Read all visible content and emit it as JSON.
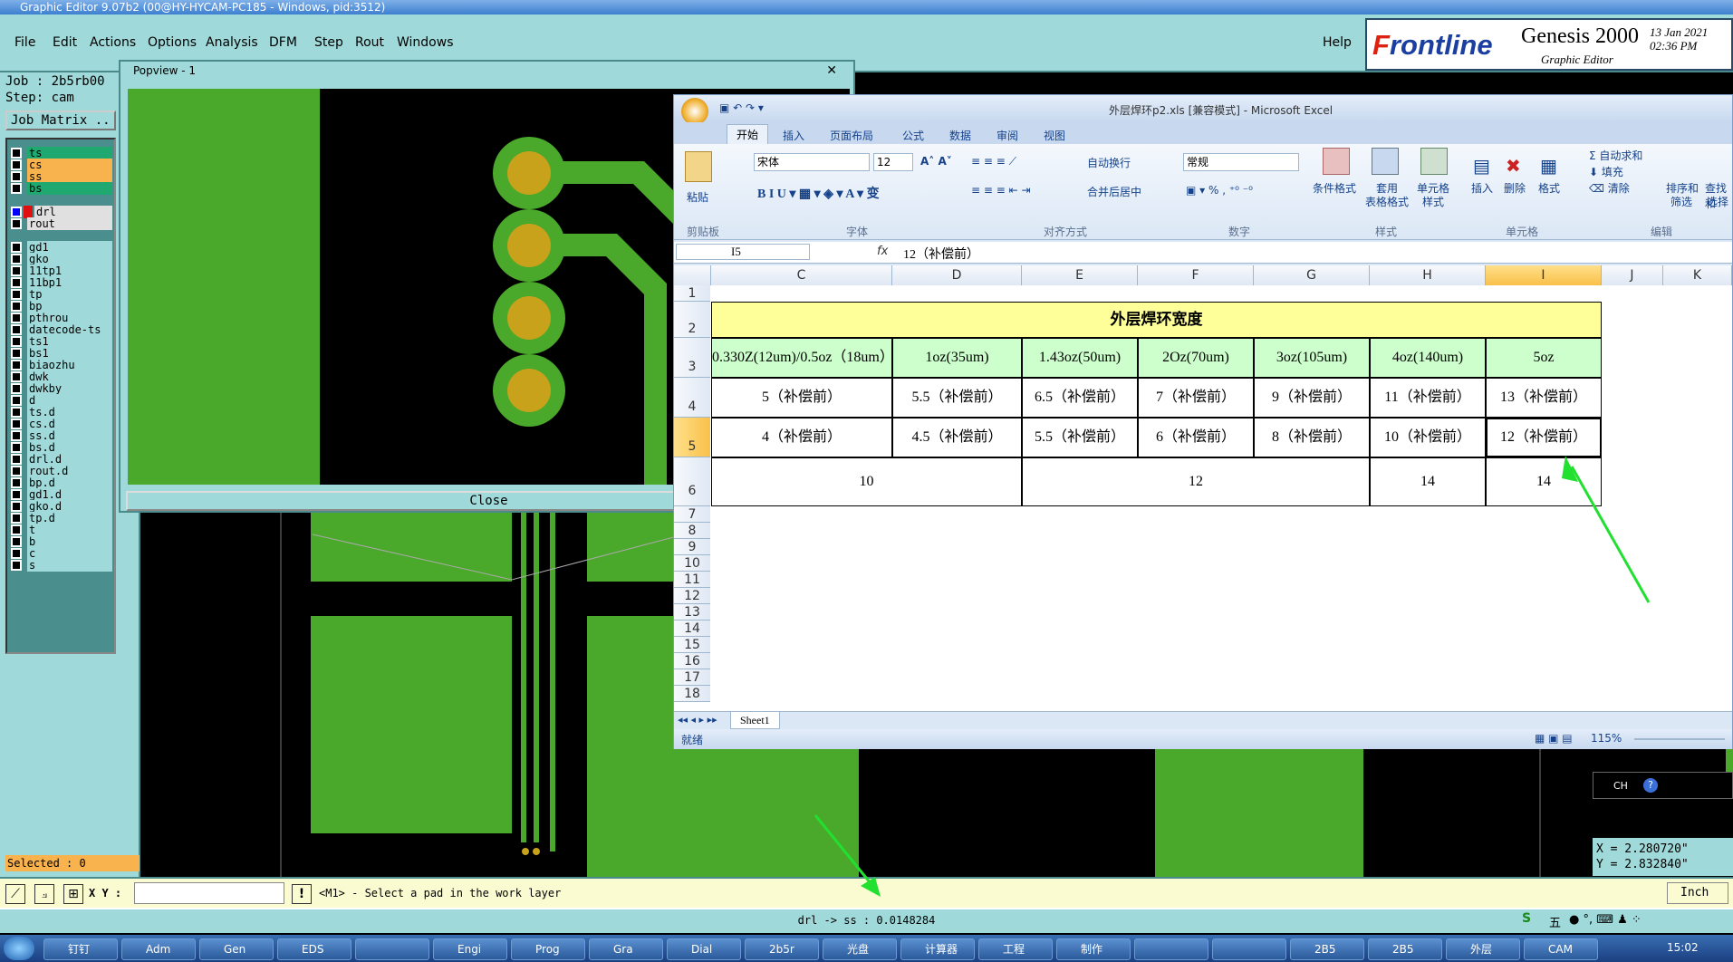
{
  "genesis": {
    "title": "Graphic Editor 9.07b2 (00@HY-HYCAM-PC185 - Windows, pid:3512)",
    "menus": [
      "File",
      "Edit",
      "Actions",
      "Options",
      "Analysis",
      "DFM",
      "Step",
      "Rout",
      "Windows"
    ],
    "help": "Help",
    "logo": {
      "brand_a": "F",
      "brand_b": "rontline",
      "product": "Genesis 2000",
      "sub": "Graphic Editor",
      "date": "13 Jan 2021",
      "time": "02:36 PM"
    },
    "job": "Job : 2b5rb00",
    "step": "Step: cam",
    "job_matrix": "Job Matrix ..",
    "layers": [
      {
        "name": "ts",
        "color": "#1fa971"
      },
      {
        "name": "cs",
        "color": "#f9b34e"
      },
      {
        "name": "ss",
        "color": "#f9b34e"
      },
      {
        "name": "bs",
        "color": "#1fa971"
      },
      {
        "name": "drl",
        "color": "#e0e0e0",
        "active": true
      },
      {
        "name": "rout",
        "color": "#e0e0e0"
      },
      {
        "name": "gd1",
        "color": "#9fd9d9"
      },
      {
        "name": "gko",
        "color": "#9fd9d9"
      },
      {
        "name": "11tp1",
        "color": "#9fd9d9"
      },
      {
        "name": "11bp1",
        "color": "#9fd9d9"
      },
      {
        "name": "tp",
        "color": "#9fd9d9"
      },
      {
        "name": "bp",
        "color": "#9fd9d9"
      },
      {
        "name": "pthrou",
        "color": "#9fd9d9"
      },
      {
        "name": "datecode-ts",
        "color": "#9fd9d9"
      },
      {
        "name": "ts1",
        "color": "#9fd9d9"
      },
      {
        "name": "bs1",
        "color": "#9fd9d9"
      },
      {
        "name": "biaozhu",
        "color": "#9fd9d9"
      },
      {
        "name": "dwk",
        "color": "#9fd9d9"
      },
      {
        "name": "dwkby",
        "color": "#9fd9d9"
      },
      {
        "name": "d",
        "color": "#9fd9d9"
      },
      {
        "name": "ts.d",
        "color": "#9fd9d9"
      },
      {
        "name": "cs.d",
        "color": "#9fd9d9"
      },
      {
        "name": "ss.d",
        "color": "#9fd9d9"
      },
      {
        "name": "bs.d",
        "color": "#9fd9d9"
      },
      {
        "name": "drl.d",
        "color": "#9fd9d9"
      },
      {
        "name": "rout.d",
        "color": "#9fd9d9"
      },
      {
        "name": "bp.d",
        "color": "#9fd9d9"
      },
      {
        "name": "gd1.d",
        "color": "#9fd9d9"
      },
      {
        "name": "gko.d",
        "color": "#9fd9d9"
      },
      {
        "name": "tp.d",
        "color": "#9fd9d9"
      },
      {
        "name": "t",
        "color": "#9fd9d9"
      },
      {
        "name": "b",
        "color": "#9fd9d9"
      },
      {
        "name": "c",
        "color": "#9fd9d9"
      },
      {
        "name": "s",
        "color": "#9fd9d9"
      }
    ],
    "selected": "Selected : 0",
    "xy_label": "X Y :",
    "prompt": "<M1> - Select a pad in the work layer",
    "units": "Inch",
    "coord_x": "X = 2.280720\"",
    "coord_y": "Y = 2.832840\"",
    "status": "drl -> ss : 0.0148284",
    "ime": "CH",
    "ime_mode": "五"
  },
  "popview": {
    "title": "Popview - 1",
    "close": "Close"
  },
  "excel": {
    "title": "外层焊环p2.xls  [兼容模式]  -  Microsoft Excel",
    "tabs": [
      "开始",
      "插入",
      "页面布局",
      "公式",
      "数据",
      "审阅",
      "视图"
    ],
    "font_name": "宋体",
    "font_size": "12",
    "number_format": "常规",
    "ribbon": {
      "paste": "粘贴",
      "wrap": "自动换行",
      "merge": "合并后居中",
      "cond": "条件格式",
      "table_a": "套用",
      "table_b": "表格格式",
      "cell_a": "单元格",
      "cell_b": "样式",
      "insert": "插入",
      "delete": "删除",
      "format": "格式",
      "autosum": "自动求和",
      "fill": "填充",
      "clear": "清除",
      "sort_a": "排序和",
      "sort_b": "筛选",
      "find_a": "查找和",
      "find_b": "选择",
      "groups": [
        "剪贴板",
        "字体",
        "对齐方式",
        "数字",
        "样式",
        "单元格",
        "编辑"
      ]
    },
    "name_box": "I5",
    "formula": "12（补偿前）",
    "columns": [
      "C",
      "D",
      "E",
      "F",
      "G",
      "H",
      "I",
      "J",
      "K"
    ],
    "rows": [
      "1",
      "2",
      "3",
      "4",
      "5",
      "6",
      "7",
      "8",
      "9",
      "10",
      "11",
      "12",
      "13",
      "14",
      "15",
      "16",
      "17",
      "18"
    ],
    "table_title": "外层焊环宽度",
    "headers": [
      "0.330Z(12um)/0.5oz（18um）",
      "1oz(35um)",
      "1.43oz(50um)",
      "2Oz(70um)",
      "3oz(105um)",
      "4oz(140um)",
      "5oz"
    ],
    "row4": [
      "5（补偿前）",
      "5.5（补偿前）",
      "6.5（补偿前）",
      "7（补偿前）",
      "9（补偿前）",
      "11（补偿前）",
      "13（补偿前）"
    ],
    "row5": [
      "4（补偿前）",
      "4.5（补偿前）",
      "5.5（补偿前）",
      "6（补偿前）",
      "8（补偿前）",
      "10（补偿前）",
      "12（补偿前）"
    ],
    "row6": [
      "10",
      "12",
      "14",
      "14"
    ],
    "sheet": "Sheet1",
    "ready": "就绪",
    "zoom": "115%"
  },
  "taskbar": {
    "time": "15:02",
    "items": [
      "钉钉",
      "Adm",
      "Gen",
      "EDS",
      "",
      "Engi",
      "Prog",
      "Gra",
      "Dial",
      "2b5r",
      "光盘",
      "计算器",
      "工程",
      "制作",
      "",
      "",
      "2B5",
      "2B5",
      "外层",
      "CAM"
    ]
  }
}
